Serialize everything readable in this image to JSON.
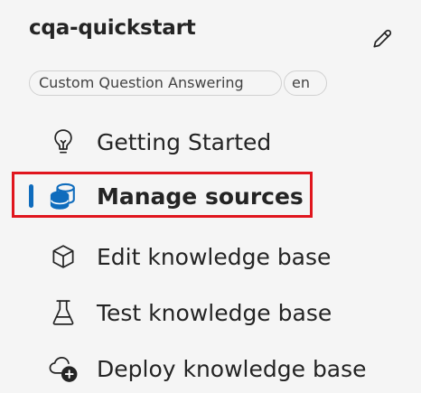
{
  "project": {
    "title": "cqa-quickstart",
    "tags": [
      "Custom Question Answering",
      "en"
    ]
  },
  "nav": {
    "items": [
      {
        "label": "Getting Started",
        "icon": "lightbulb-icon",
        "active": false
      },
      {
        "label": "Manage sources",
        "icon": "database-icon",
        "active": true
      },
      {
        "label": "Edit knowledge base",
        "icon": "cube-icon",
        "active": false
      },
      {
        "label": "Test knowledge base",
        "icon": "beaker-icon",
        "active": false
      },
      {
        "label": "Deploy knowledge base",
        "icon": "cloud-add-icon",
        "active": false
      }
    ]
  },
  "colors": {
    "accent": "#0f6cbd",
    "highlight": "#e0161e",
    "background": "#f5f5f5"
  }
}
